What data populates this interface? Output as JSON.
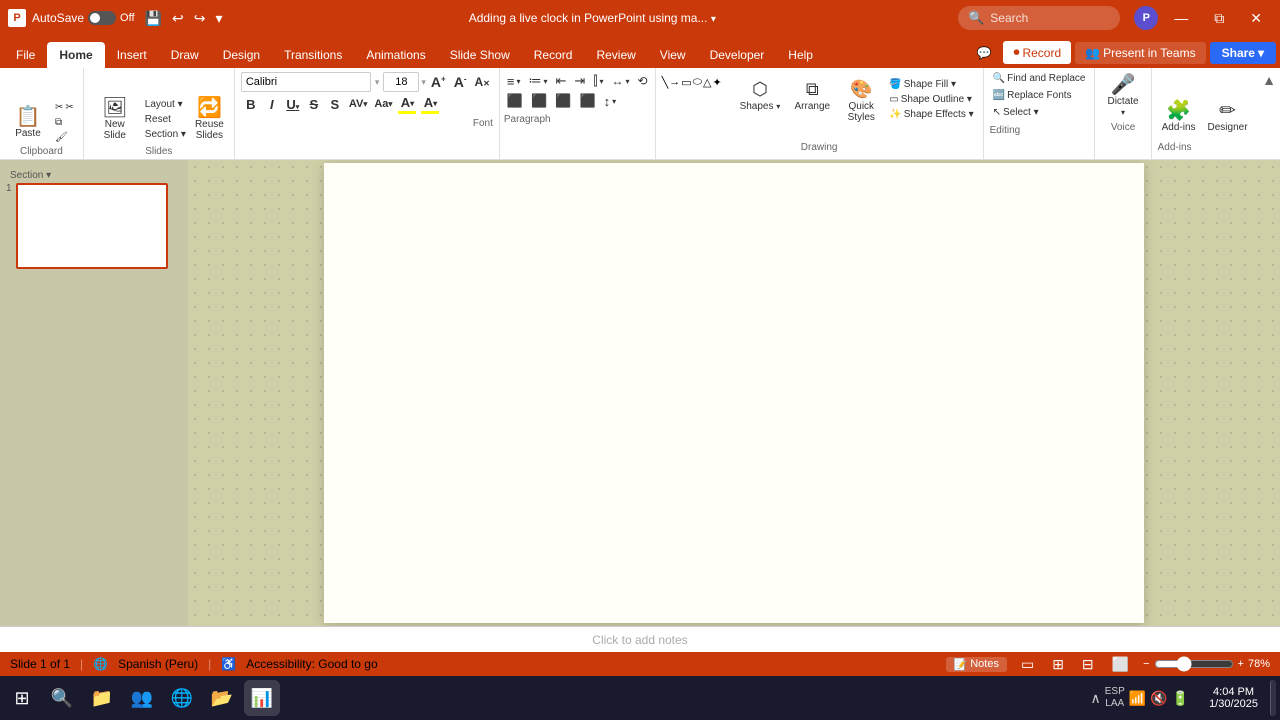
{
  "titlebar": {
    "app_name": "P",
    "autosave_label": "AutoSave",
    "autosave_state": "Off",
    "undo_icon": "↩",
    "redo_icon": "↪",
    "dropdown_icon": "▾",
    "title": "Adding a live clock in PowerPoint using ma...",
    "title_dropdown": "▾",
    "search_placeholder": "Search",
    "minimize": "—",
    "restore": "⧉",
    "close": "✕",
    "user_initial": "P",
    "colors": {
      "bg": "#c9390a",
      "user_avatar": "#5b4fcf"
    }
  },
  "ribbon_tabs": {
    "tabs": [
      "File",
      "Home",
      "Insert",
      "Draw",
      "Design",
      "Transitions",
      "Animations",
      "Slide Show",
      "Record",
      "Review",
      "View",
      "Developer",
      "Help"
    ],
    "active_tab": "Home"
  },
  "ribbon_right": {
    "comment_icon": "💬",
    "record_icon": "⏺",
    "record_label": "Record",
    "present_icon": "👥",
    "present_label": "Present in Teams",
    "share_label": "Share",
    "share_icon": "▾"
  },
  "ribbon_clipboard": {
    "paste_label": "Paste",
    "cut_icon": "✂",
    "copy_icon": "⧉",
    "format_painter_icon": "🖌",
    "group_label": "Clipboard"
  },
  "ribbon_slides": {
    "new_slide_label": "New\nSlide",
    "layout_label": "Layout ▾",
    "reset_label": "Reset",
    "reuse_label": "Reuse\nSlides",
    "section_label": "Section ▾",
    "group_label": "Slides"
  },
  "ribbon_font": {
    "font_name": "Calibri",
    "font_size": "18",
    "grow_icon": "A↑",
    "shrink_icon": "A↓",
    "clear_icon": "A✕",
    "bold": "B",
    "italic": "I",
    "underline": "U",
    "strikethrough": "S",
    "shadow": "S²",
    "spacing_icon": "AV",
    "case_icon": "Aa",
    "color_icon": "A",
    "highlight_icon": "A",
    "group_label": "Font"
  },
  "ribbon_paragraph": {
    "bullets_icon": "≡",
    "numbering_icon": "≔",
    "decrease_icon": "⇤",
    "increase_icon": "⇥",
    "columns_icon": "⫿",
    "align_left": "≡",
    "align_center": "≡",
    "align_right": "≡",
    "justify": "≡",
    "line_spacing": "↕",
    "text_dir": "↔",
    "convert": "⟲",
    "group_label": "Paragraph"
  },
  "ribbon_drawing": {
    "arrange_label": "Arrange",
    "quick_styles_label": "Quick\nStyles",
    "shape_fill_label": "Shape Fill ▾",
    "shape_outline_label": "Shape Outline ▾",
    "shape_effects_label": "Shape Effects ▾",
    "group_label": "Drawing"
  },
  "ribbon_editing": {
    "find_replace_label": "Find and Replace",
    "replace_fonts_label": "Replace Fonts",
    "select_label": "Select ▾",
    "group_label": "Editing"
  },
  "ribbon_voice": {
    "dictate_label": "Dictate",
    "dictate_icon": "🎤",
    "group_label": "Voice"
  },
  "ribbon_addins": {
    "addins_label": "Add-ins",
    "designer_label": "Designer",
    "group_label": "Add-ins"
  },
  "slide_panel": {
    "slide_number": "1",
    "section_label": "Section ▾"
  },
  "slide_canvas": {
    "notes_placeholder": "Click to add notes"
  },
  "status_bar": {
    "slide_info": "Slide 1 of 1",
    "language_icon": "🌐",
    "language": "Spanish (Peru)",
    "accessibility_icon": "♿",
    "accessibility": "Accessibility: Good to go",
    "notes_label": "Notes",
    "view_normal": "▭",
    "view_grid": "⊞",
    "view_reader": "⊟",
    "view_presenter": "⬜",
    "zoom_out": "−",
    "zoom_in": "+",
    "zoom_percent": "78%"
  },
  "taskbar": {
    "start_icon": "⊞",
    "search_icon": "🔍",
    "files_icon": "📁",
    "teams_icon": "👥",
    "chrome_icon": "🌐",
    "explorer_icon": "📂",
    "powerpoint_icon": "📊",
    "tray_items": [
      "∧",
      "🔇",
      "📶",
      "🔋"
    ],
    "clock_time": "4:04 PM",
    "clock_date": "1/30/2025",
    "language_code": "ESP\nLAA",
    "show_desktop": "▮"
  }
}
